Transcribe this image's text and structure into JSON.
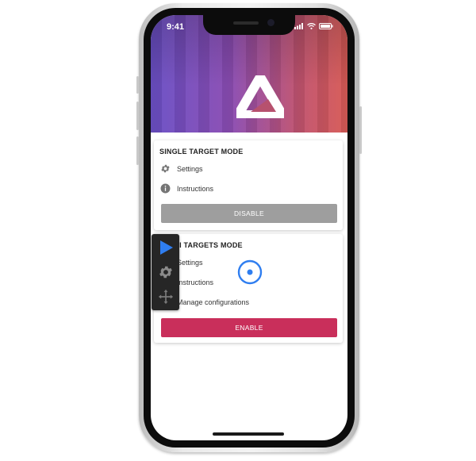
{
  "status": {
    "time": "9:41"
  },
  "single_mode": {
    "title": "SINGLE TARGET MODE",
    "items": [
      {
        "label": "Settings",
        "icon": "gear-icon"
      },
      {
        "label": "Instructions",
        "icon": "info-icon"
      }
    ],
    "button": "DISABLE"
  },
  "multi_mode": {
    "title": "MULTI TARGETS MODE",
    "items": [
      {
        "label": "Settings",
        "icon": "gear-icon"
      },
      {
        "label": "Instructions",
        "icon": "info-icon"
      },
      {
        "label": "Manage configurations",
        "icon": "list-icon"
      }
    ],
    "button": "ENABLE"
  },
  "toolbar": {
    "icons": [
      "play-icon",
      "gear-icon",
      "move-icon"
    ]
  },
  "colors": {
    "accent": "#c92f5b",
    "disabled": "#9e9e9e",
    "toolbar": "#262626",
    "play": "#2f7ef0"
  }
}
